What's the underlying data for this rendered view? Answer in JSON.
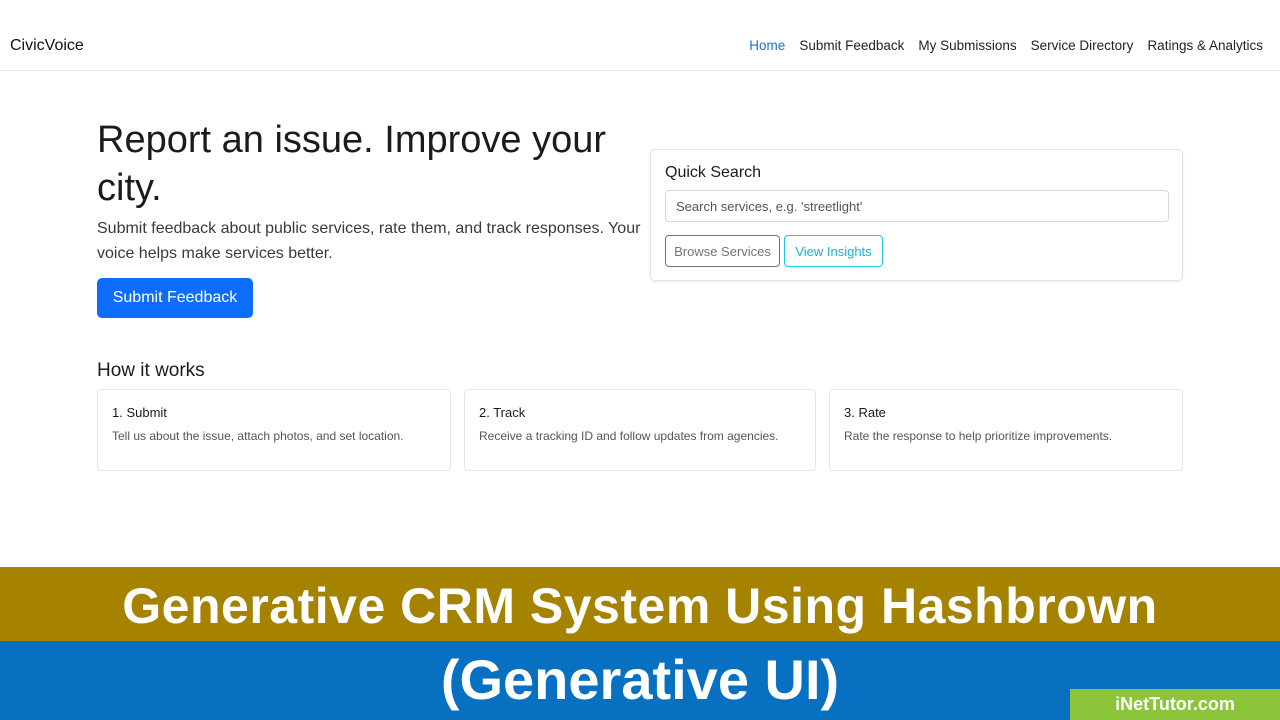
{
  "navbar": {
    "brand": "CivicVoice",
    "links": [
      {
        "label": "Home",
        "active": true
      },
      {
        "label": "Submit Feedback",
        "active": false
      },
      {
        "label": "My Submissions",
        "active": false
      },
      {
        "label": "Service Directory",
        "active": false
      },
      {
        "label": "Ratings & Analytics",
        "active": false
      }
    ]
  },
  "hero": {
    "title": "Report an issue. Improve your city.",
    "subtitle": "Submit feedback about public services, rate them, and track responses. Your voice helps make services better.",
    "cta_label": "Submit Feedback"
  },
  "quick_search": {
    "title": "Quick Search",
    "placeholder": "Search services, e.g. 'streetlight'",
    "browse_label": "Browse Services",
    "insights_label": "View Insights"
  },
  "how_it_works": {
    "title": "How it works",
    "steps": [
      {
        "title": "1. Submit",
        "text": "Tell us about the issue, attach photos, and set location."
      },
      {
        "title": "2. Track",
        "text": "Receive a tracking ID and follow updates from agencies."
      },
      {
        "title": "3. Rate",
        "text": "Rate the response to help prioritize improvements."
      }
    ]
  },
  "banner": {
    "line1": "Generative CRM System Using Hashbrown",
    "line2": "(Generative UI)",
    "watermark": "iNetTutor.com"
  },
  "colors": {
    "primary": "#0d6efd",
    "nav_active": "#1f6fd1",
    "banner_gold": "#a58300",
    "banner_blue": "#0770c0",
    "watermark_green": "#8cc43a"
  }
}
